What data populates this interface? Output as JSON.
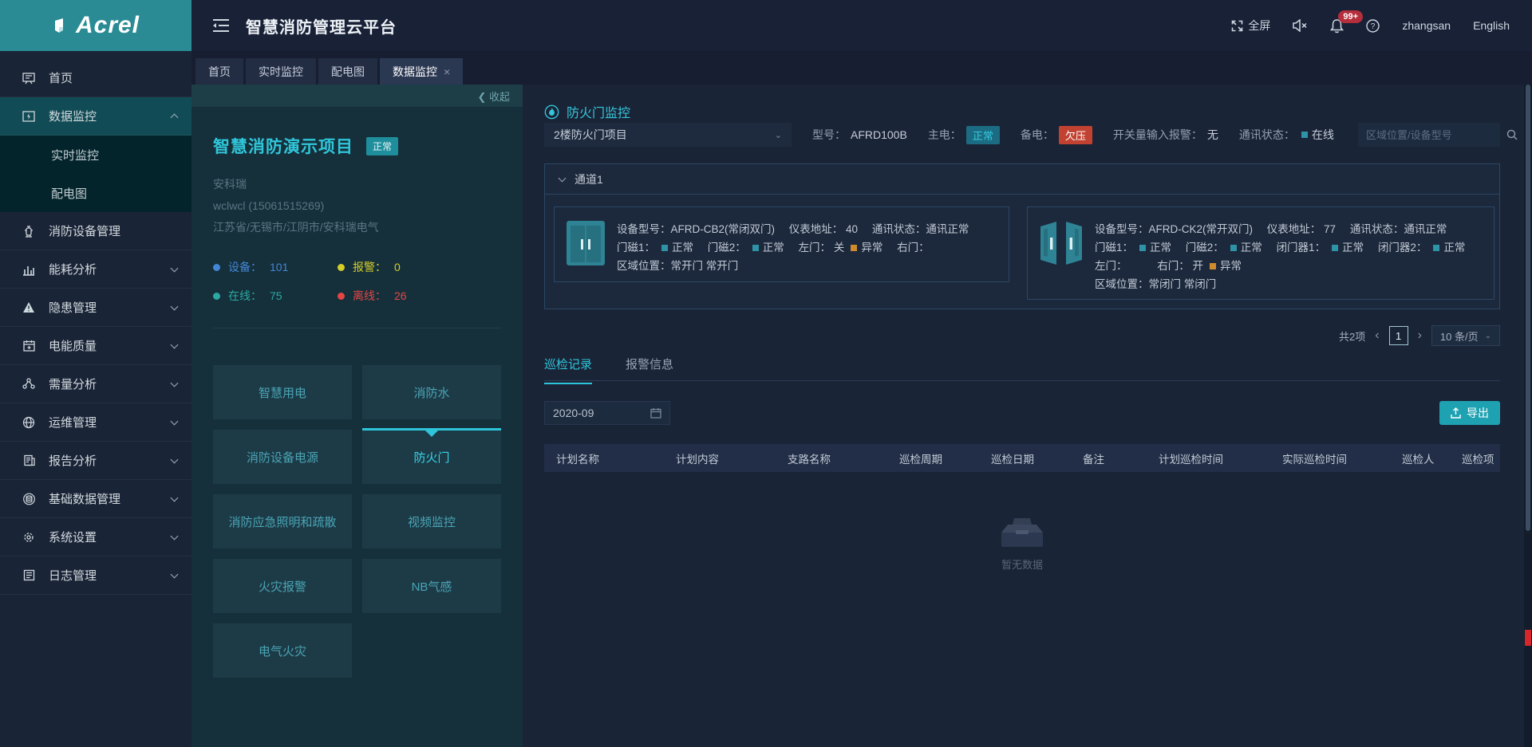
{
  "colors": {
    "accent_cyan": "#36c9dd",
    "logo_bg": "#2a8b94",
    "status_normal_square": "#2d93a5",
    "status_abnormal_square": "#d08a2e",
    "main_power_badge_bg": "#1b6c82",
    "backup_power_badge_bg": "#c24231",
    "project_status_badge_bg": "#1f8e9c",
    "export_button_bg": "#1ea2b2",
    "notification_badge_bg": "#b52e3c",
    "stat_device": "#4486d6",
    "stat_alarm": "#d6cd28",
    "stat_online": "#2ba9a2",
    "stat_offline": "#e34644"
  },
  "header": {
    "logo": "Acrel",
    "title": "智慧消防管理云平台",
    "fullscreen_label": "全屏",
    "notification_badge": "99+",
    "username": "zhangsan",
    "language": "English"
  },
  "workspace_tabs": [
    {
      "label": "首页"
    },
    {
      "label": "实时监控"
    },
    {
      "label": "配电图"
    },
    {
      "label": "数据监控",
      "close": "×"
    }
  ],
  "sidebar": {
    "items": [
      {
        "label": "首页"
      },
      {
        "label": "数据监控"
      },
      {
        "label": "实时监控"
      },
      {
        "label": "配电图"
      },
      {
        "label": "消防设备管理"
      },
      {
        "label": "能耗分析"
      },
      {
        "label": "隐患管理"
      },
      {
        "label": "电能质量"
      },
      {
        "label": "需量分析"
      },
      {
        "label": "运维管理"
      },
      {
        "label": "报告分析"
      },
      {
        "label": "基础数据管理"
      },
      {
        "label": "系统设置"
      },
      {
        "label": "日志管理"
      }
    ]
  },
  "project": {
    "collapse_label": "收起",
    "name": "智慧消防演示项目",
    "status": "正常",
    "company": "安科瑞",
    "contact": "wclwcl (15061515269)",
    "region": "江苏省/无锡市/江阴市/安科瑞电气",
    "stats": [
      {
        "label": "设备：",
        "value": "101"
      },
      {
        "label": "报警：",
        "value": "0"
      },
      {
        "label": "在线：",
        "value": "75"
      },
      {
        "label": "离线：",
        "value": "26"
      }
    ],
    "categories": [
      {
        "label": "智慧用电"
      },
      {
        "label": "消防水"
      },
      {
        "label": "消防设备电源"
      },
      {
        "label": "防火门"
      },
      {
        "label": "消防应急照明和疏散"
      },
      {
        "label": "视频监控"
      },
      {
        "label": "火灾报警"
      },
      {
        "label": "NB气感"
      },
      {
        "label": "电气火灾"
      }
    ]
  },
  "monitor": {
    "title": "防火门监控",
    "project_select": "2楼防火门项目",
    "model_label": "型号：",
    "model_value": "AFRD100B",
    "main_power_label": "主电：",
    "main_power_value": "正常",
    "backup_power_label": "备电：",
    "backup_power_value": "欠压",
    "di_alarm_label": "开关量输入报警：",
    "di_alarm_value": "无",
    "comm_label": "通讯状态：",
    "comm_value": "在线",
    "search_placeholder": "区域位置/设备型号",
    "channel_title": "通道1",
    "devices": [
      {
        "model_label": "设备型号：",
        "model": "AFRD-CB2(常闭双门)",
        "address_label": "仪表地址：",
        "address": "40",
        "comm_label": "通讯状态：",
        "comm": "通讯正常",
        "door1_label": "门磁1：",
        "door1": "正常",
        "door2_label": "门磁2：",
        "door2": "正常",
        "left_label": "左门：",
        "left": "关",
        "left_state": "异常",
        "right_label": "右门：",
        "right": "",
        "location_label": "区域位置：",
        "location": "常开门 常开门"
      },
      {
        "model_label": "设备型号：",
        "model": "AFRD-CK2(常开双门)",
        "address_label": "仪表地址：",
        "address": "77",
        "comm_label": "通讯状态：",
        "comm": "通讯正常",
        "door1_label": "门磁1：",
        "door1": "正常",
        "door2_label": "门磁2：",
        "door2": "正常",
        "closer1_label": "闭门器1：",
        "closer1": "正常",
        "closer2_label": "闭门器2：",
        "closer2": "正常",
        "left_label": "左门：",
        "left": "",
        "right_label": "右门：",
        "right": "开",
        "right_state": "异常",
        "location_label": "区域位置：",
        "location": "常闭门 常闭门"
      }
    ],
    "pagination": {
      "total": "共2项",
      "page": "1",
      "page_size": "10 条/页"
    },
    "record_tabs": [
      {
        "label": "巡检记录"
      },
      {
        "label": "报警信息"
      }
    ],
    "date_value": "2020-09",
    "export_label": "导出",
    "table_headers": [
      "计划名称",
      "计划内容",
      "支路名称",
      "巡检周期",
      "巡检日期",
      "备注",
      "计划巡检时间",
      "实际巡检时间",
      "巡检人",
      "巡检项"
    ],
    "empty_text": "暂无数据"
  }
}
